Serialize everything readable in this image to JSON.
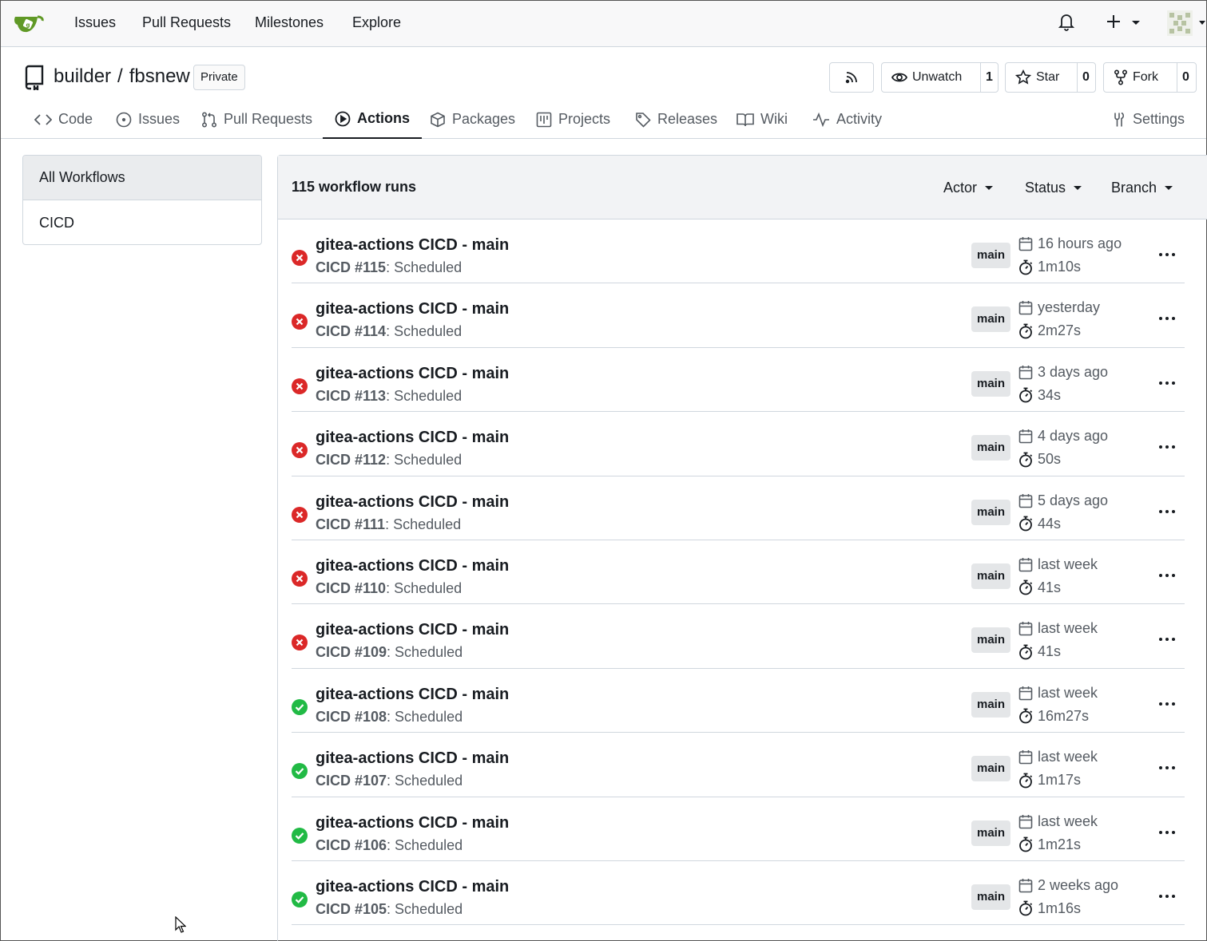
{
  "navbar": {
    "items": [
      "Issues",
      "Pull Requests",
      "Milestones",
      "Explore"
    ]
  },
  "repo": {
    "owner": "builder",
    "separator": "/",
    "name": "fbsnew",
    "visibility": "Private",
    "unwatch_label": "Unwatch",
    "watch_count": "1",
    "star_label": "Star",
    "star_count": "0",
    "fork_label": "Fork",
    "fork_count": "0"
  },
  "tabs": {
    "code": "Code",
    "issues": "Issues",
    "pulls": "Pull Requests",
    "actions": "Actions",
    "packages": "Packages",
    "projects": "Projects",
    "releases": "Releases",
    "wiki": "Wiki",
    "activity": "Activity",
    "settings": "Settings"
  },
  "sidebar": {
    "items": [
      {
        "label": "All Workflows",
        "active": true
      },
      {
        "label": "CICD",
        "active": false
      }
    ]
  },
  "runs": {
    "count_label": "115 workflow runs",
    "filters": {
      "actor": "Actor",
      "status": "Status",
      "branch": "Branch"
    },
    "colors": {
      "failure": "#db2828",
      "success": "#21ba45"
    },
    "items": [
      {
        "title": "gitea-actions CICD - main",
        "run": "CICD #115",
        "trigger": ": Scheduled",
        "branch": "main",
        "when": "16 hours ago",
        "duration": "1m10s",
        "status": "failure"
      },
      {
        "title": "gitea-actions CICD - main",
        "run": "CICD #114",
        "trigger": ": Scheduled",
        "branch": "main",
        "when": "yesterday",
        "duration": "2m27s",
        "status": "failure"
      },
      {
        "title": "gitea-actions CICD - main",
        "run": "CICD #113",
        "trigger": ": Scheduled",
        "branch": "main",
        "when": "3 days ago",
        "duration": "34s",
        "status": "failure"
      },
      {
        "title": "gitea-actions CICD - main",
        "run": "CICD #112",
        "trigger": ": Scheduled",
        "branch": "main",
        "when": "4 days ago",
        "duration": "50s",
        "status": "failure"
      },
      {
        "title": "gitea-actions CICD - main",
        "run": "CICD #111",
        "trigger": ": Scheduled",
        "branch": "main",
        "when": "5 days ago",
        "duration": "44s",
        "status": "failure"
      },
      {
        "title": "gitea-actions CICD - main",
        "run": "CICD #110",
        "trigger": ": Scheduled",
        "branch": "main",
        "when": "last week",
        "duration": "41s",
        "status": "failure"
      },
      {
        "title": "gitea-actions CICD - main",
        "run": "CICD #109",
        "trigger": ": Scheduled",
        "branch": "main",
        "when": "last week",
        "duration": "41s",
        "status": "failure"
      },
      {
        "title": "gitea-actions CICD - main",
        "run": "CICD #108",
        "trigger": ": Scheduled",
        "branch": "main",
        "when": "last week",
        "duration": "16m27s",
        "status": "success"
      },
      {
        "title": "gitea-actions CICD - main",
        "run": "CICD #107",
        "trigger": ": Scheduled",
        "branch": "main",
        "when": "last week",
        "duration": "1m17s",
        "status": "success"
      },
      {
        "title": "gitea-actions CICD - main",
        "run": "CICD #106",
        "trigger": ": Scheduled",
        "branch": "main",
        "when": "last week",
        "duration": "1m21s",
        "status": "success"
      },
      {
        "title": "gitea-actions CICD - main",
        "run": "CICD #105",
        "trigger": ": Scheduled",
        "branch": "main",
        "when": "2 weeks ago",
        "duration": "1m16s",
        "status": "success"
      }
    ]
  }
}
